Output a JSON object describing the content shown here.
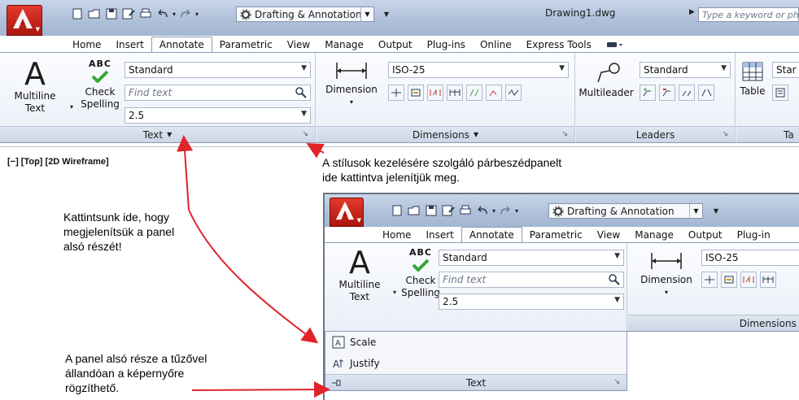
{
  "window": {
    "workspace": "Drafting & Annotation",
    "document_title": "Drawing1.dwg",
    "search_placeholder": "Type a keyword or phrase"
  },
  "tabs": [
    "Home",
    "Insert",
    "Annotate",
    "Parametric",
    "View",
    "Manage",
    "Output",
    "Plug-ins",
    "Online",
    "Express Tools"
  ],
  "active_tab": "Annotate",
  "panels": {
    "text": {
      "title": "Text",
      "multiline_text": [
        "Multiline",
        "Text"
      ],
      "check_spelling": [
        "Check",
        "Spelling"
      ],
      "spelling_badge": "ABC",
      "style": "Standard",
      "find_placeholder": "Find text",
      "height": "2.5"
    },
    "dimensions": {
      "title": "Dimensions",
      "dimension_label": "Dimension",
      "style": "ISO-25"
    },
    "leaders": {
      "title": "Leaders",
      "multileader_label": "Multileader",
      "style": "Standard"
    },
    "tables": {
      "title_partial": "Ta",
      "table_label": "Table",
      "style_partial": "Star"
    }
  },
  "viewport": {
    "label": "[−] [Top] [2D Wireframe]"
  },
  "zoom": {
    "tabs_visible": [
      "Home",
      "Insert",
      "Annotate",
      "Parametric",
      "View",
      "Manage",
      "Output",
      "Plug-in"
    ],
    "dimensions_title": "Dimensions",
    "slideout_items": [
      "Scale",
      "Justify"
    ],
    "slideout_title": "Text"
  },
  "annotations": {
    "styles_note": [
      "A stílusok kezelésére szolgáló párbeszédpanelt",
      "ide kattintva jelenítjük meg."
    ],
    "expand_note": [
      "Kattintsunk ide, hogy",
      "megjelenítsük a panel",
      "alsó részét!"
    ],
    "pin_note": [
      "A panel alsó része a tűzővel",
      "állandóan a képernyőre",
      "rögzíthető."
    ]
  },
  "colors": {
    "accent_red": "#e0242a",
    "ribbon_blue": "#aebfd8",
    "check_green": "#36a63a"
  }
}
